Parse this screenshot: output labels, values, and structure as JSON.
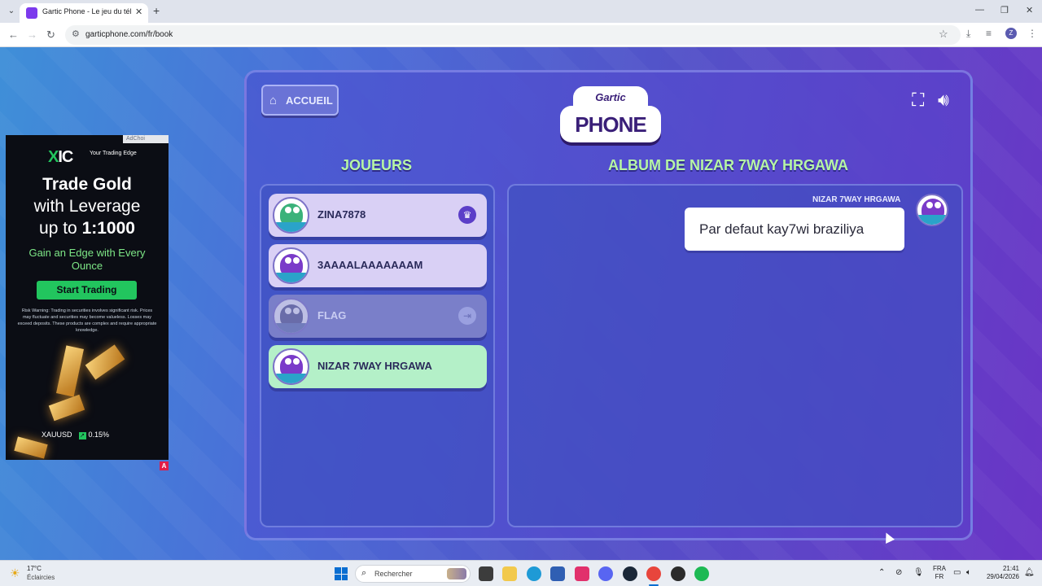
{
  "browser": {
    "tab_title": "Gartic Phone - Le jeu du téléph",
    "tab_close": "✕",
    "new_tab": "+",
    "url": "garticphone.com/fr/book",
    "window_controls": {
      "minimize": "—",
      "restore": "❐",
      "close": "✕"
    },
    "profile_initial": "Z"
  },
  "ad": {
    "adchoices": "AdChoi",
    "brand": "IC",
    "tagline": "Your Trading Edge",
    "headline_line1": "Trade Gold",
    "headline_line2": "with Leverage",
    "headline_line3_prefix": "up to ",
    "headline_line3_bold": "1:1000",
    "subheadline": "Gain an Edge with Every Ounce",
    "cta": "Start Trading",
    "risk_warning": "Risk Warning: Trading in securities involves significant risk. Prices may fluctuate and securities may become valueless. Losses may exceed deposits. These products are complex and require appropriate knowledge.",
    "ticker_symbol": "XAUUSD",
    "ticker_arrow": "↗",
    "ticker_change": "0.15%",
    "badge": "A"
  },
  "game": {
    "home_label": "ACCUEIL",
    "logo_top": "Gartic",
    "logo_bottom": "PHONE",
    "players_title": "JOUEURS",
    "album_title": "ALBUM DE NIZAR 7WAY HRGAWA",
    "players": [
      {
        "name": "ZINA7878",
        "badge": "♛",
        "state": "owner"
      },
      {
        "name": "3AAAALAAAAAAAM",
        "badge": "",
        "state": "normal"
      },
      {
        "name": "FLAG",
        "badge": "⇥",
        "state": "disconnected"
      },
      {
        "name": "NIZAR 7WAY HRGAWA",
        "badge": "",
        "state": "active"
      }
    ],
    "album_entry": {
      "author": "NIZAR 7WAY HRGAWA",
      "text": "Par defaut kay7wi braziliya"
    }
  },
  "taskbar": {
    "weather_temp": "17°C",
    "weather_desc": "Éclaircies",
    "search_label": "Rechercher",
    "lang_line1": "FRA",
    "lang_line2": "FR",
    "time": "21:41",
    "date": "29/04/2026"
  },
  "colors": {
    "accent_green_title": "#b6f5a6",
    "active_player": "#b4f0c8",
    "player_card": "#d9d0f5"
  }
}
